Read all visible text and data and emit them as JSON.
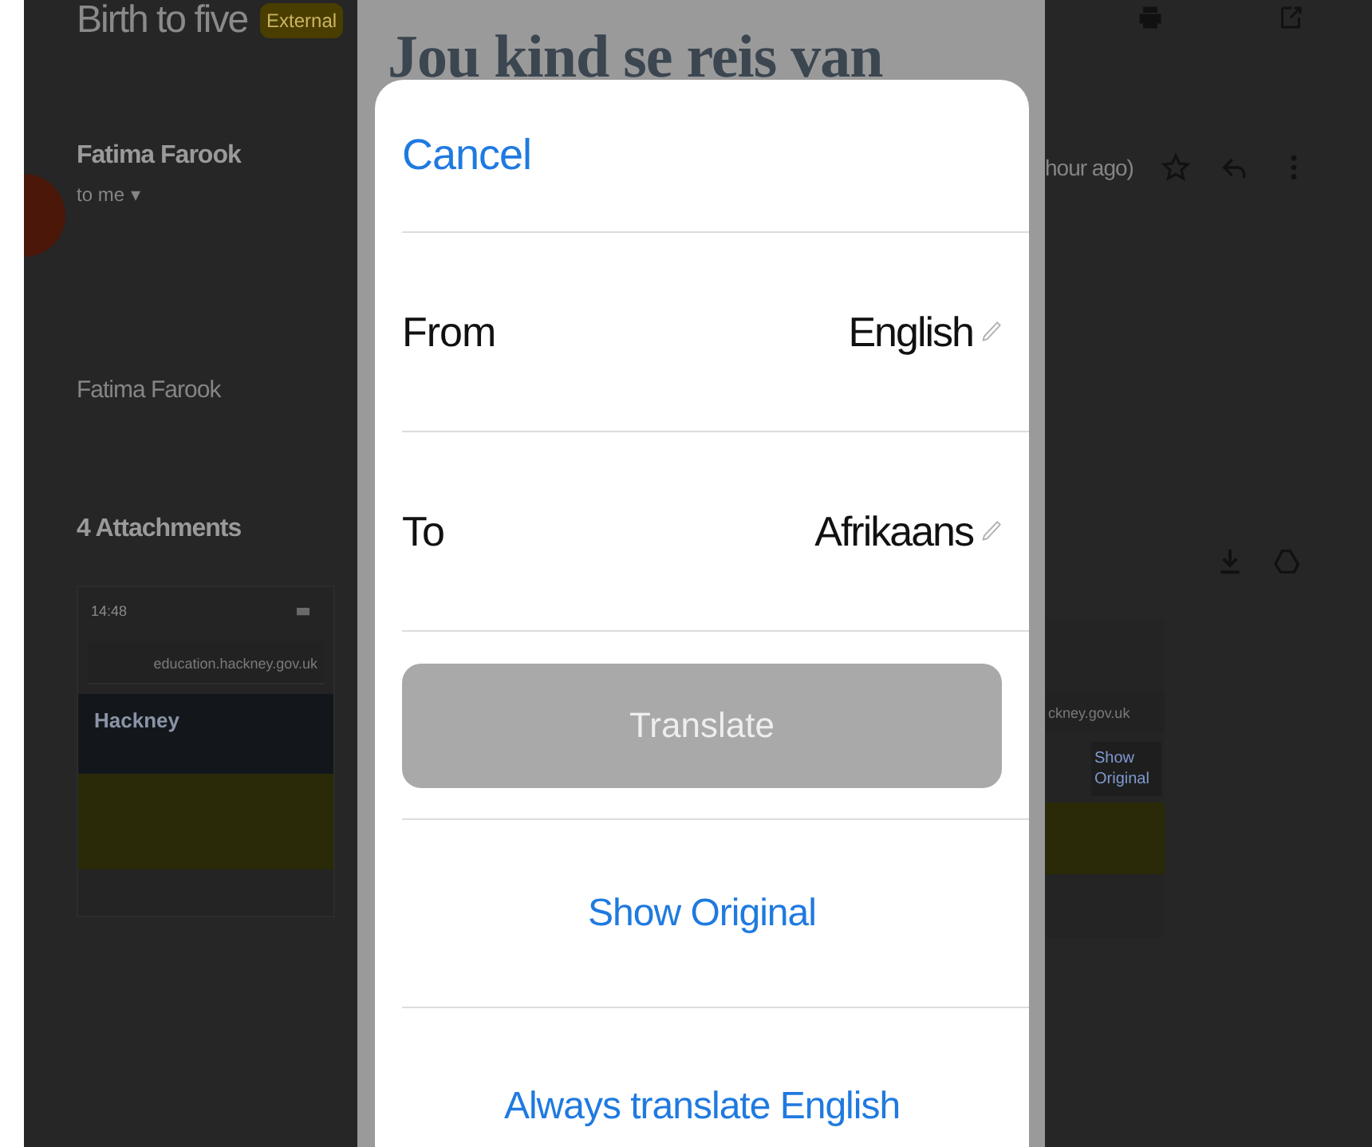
{
  "email": {
    "subject": "Birth to five",
    "badge": "External",
    "sender": "Fatima Farook",
    "recipient": "to me",
    "recipient_caret": "▾",
    "time": "hour ago)",
    "signature": "Fatima Farook",
    "attachments_heading": "4 Attachments",
    "attachments": [
      {
        "time": "14:48",
        "url": "education.hackney.gov.uk",
        "site_name": "Hackney"
      },
      {
        "url": "ckney.gov.uk",
        "translate_link": "Show Original"
      }
    ]
  },
  "page_heading": "Jou kind se reis van",
  "translate_sheet": {
    "cancel": "Cancel",
    "rows": [
      {
        "label": "From",
        "value": "English"
      },
      {
        "label": "To",
        "value": "Afrikaans"
      }
    ],
    "translate_button": {
      "label": "Translate",
      "disabled": true
    },
    "actions": [
      "Show Original",
      "Always translate English"
    ]
  }
}
